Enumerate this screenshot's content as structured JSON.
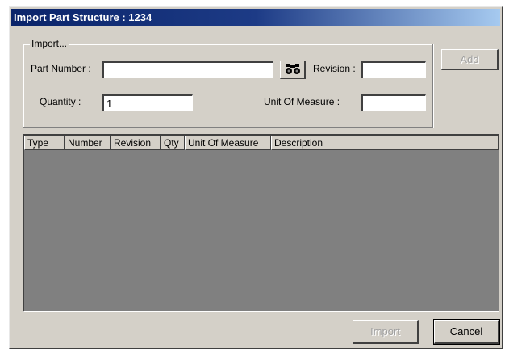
{
  "window": {
    "title": "Import Part Structure : 1234"
  },
  "import_group": {
    "legend": "Import...",
    "part_number_label": "Part Number :",
    "part_number_value": "",
    "find_icon": "binoculars-icon",
    "revision_label": "Revision :",
    "revision_value": "",
    "quantity_label": "Quantity :",
    "quantity_value": "1",
    "uom_label": "Unit Of Measure :",
    "uom_value": ""
  },
  "buttons": {
    "add": "Add",
    "import": "Import",
    "cancel": "Cancel"
  },
  "table": {
    "columns": [
      "Type",
      "Number",
      "Revision",
      "Qty",
      "Unit Of Measure",
      "Description"
    ],
    "rows": []
  },
  "colors": {
    "title_bar": "#0a246a",
    "dialog_face": "#d4d0c8",
    "list_background": "#808080"
  }
}
